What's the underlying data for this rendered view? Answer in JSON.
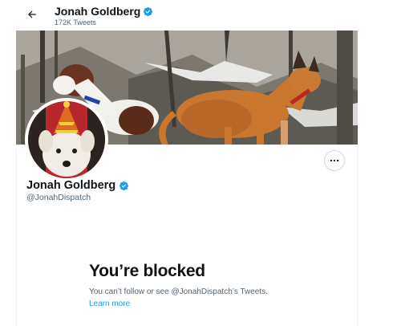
{
  "header": {
    "title": "Jonah Goldberg",
    "tweet_count": "172K Tweets"
  },
  "profile": {
    "display_name": "Jonah Goldberg",
    "handle": "@JonahDispatch",
    "verified": true
  },
  "blocked": {
    "title": "You’re blocked",
    "message": "You can’t follow or see @JonahDispatch’s Tweets.",
    "link": "Learn more"
  },
  "icons": {
    "back": "arrow-left-icon",
    "verified": "verified-badge-icon",
    "more": "more-horizontal-icon"
  },
  "colors": {
    "accent": "#1d9bf0",
    "text_primary": "#0f1419",
    "text_secondary": "#536471"
  }
}
